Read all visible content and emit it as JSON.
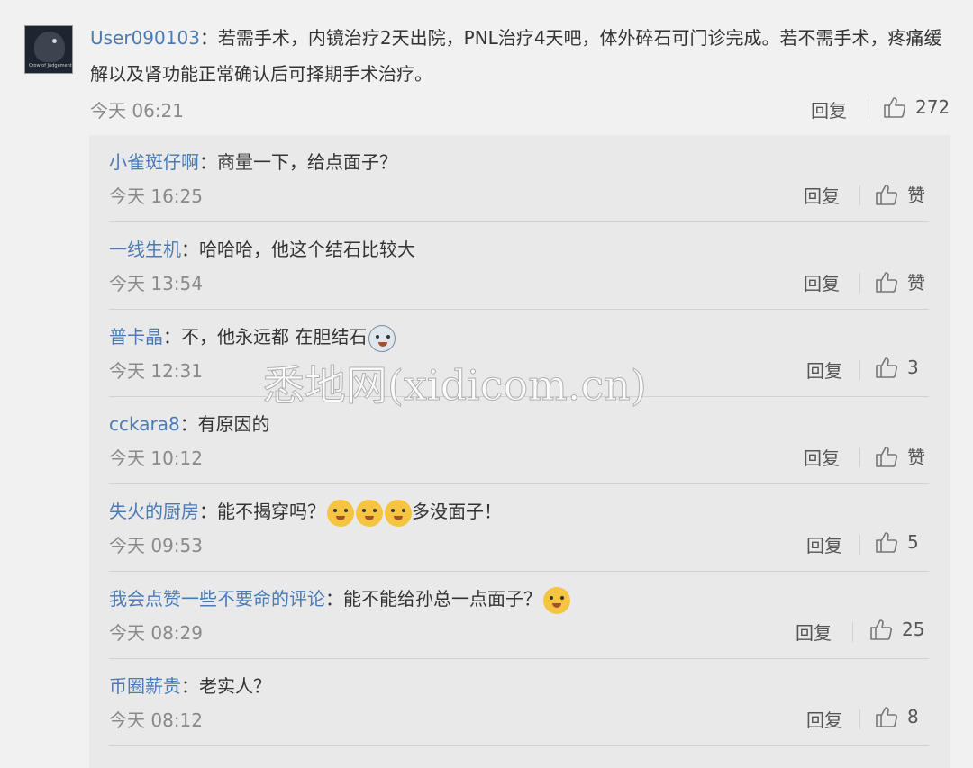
{
  "main_comment": {
    "user": "User090103",
    "text": "：若需手术，内镜治疗2天出院，PNL治疗4天吧，体外碎石可门诊完成。若不需手术，疼痛缓解以及肾功能正常确认后可择期手术治疗。",
    "time": "今天 06:21",
    "reply_label": "回复",
    "likes": "272",
    "avatar_caption": "Crow of Judgement"
  },
  "replies": [
    {
      "user": "小雀斑仔啊",
      "text": "：商量一下，给点面子？",
      "time": "今天 16:25",
      "reply_label": "回复",
      "likes": "赞",
      "emojis": 0
    },
    {
      "user": "一线生机",
      "text": "：哈哈哈，他这个结石比较大",
      "time": "今天 13:54",
      "reply_label": "回复",
      "likes": "赞",
      "emojis": 0
    },
    {
      "user": "普卡晶",
      "text": "：不，他永远都 在胆结石",
      "time": "今天 12:31",
      "reply_label": "回复",
      "likes": "3",
      "emojis": 1
    },
    {
      "user": "cckara8",
      "text": "：有原因的",
      "time": "今天 10:12",
      "reply_label": "回复",
      "likes": "赞",
      "emojis": 0
    },
    {
      "user": "失火的厨房",
      "text": "：能不揭穿吗？",
      "text_after": "多没面子！",
      "time": "今天 09:53",
      "reply_label": "回复",
      "likes": "5",
      "emojis": 3
    },
    {
      "user": "我会点赞一些不要命的评论",
      "text": "：能不能给孙总一点面子？",
      "time": "今天 08:29",
      "reply_label": "回复",
      "likes": "25",
      "emojis": 1
    },
    {
      "user": "币圈薪贵",
      "text": "：老实人？",
      "time": "今天 08:12",
      "reply_label": "回复",
      "likes": "8",
      "emojis": 0
    }
  ],
  "watermark": "悉地网(xidicom.cn)",
  "icons": {
    "like": "thumbs-up-icon",
    "emoji": "doge-emoji-icon"
  },
  "colors": {
    "username": "#4a7bb5",
    "background": "#f1f1f1",
    "panel": "#e9e9e9"
  }
}
